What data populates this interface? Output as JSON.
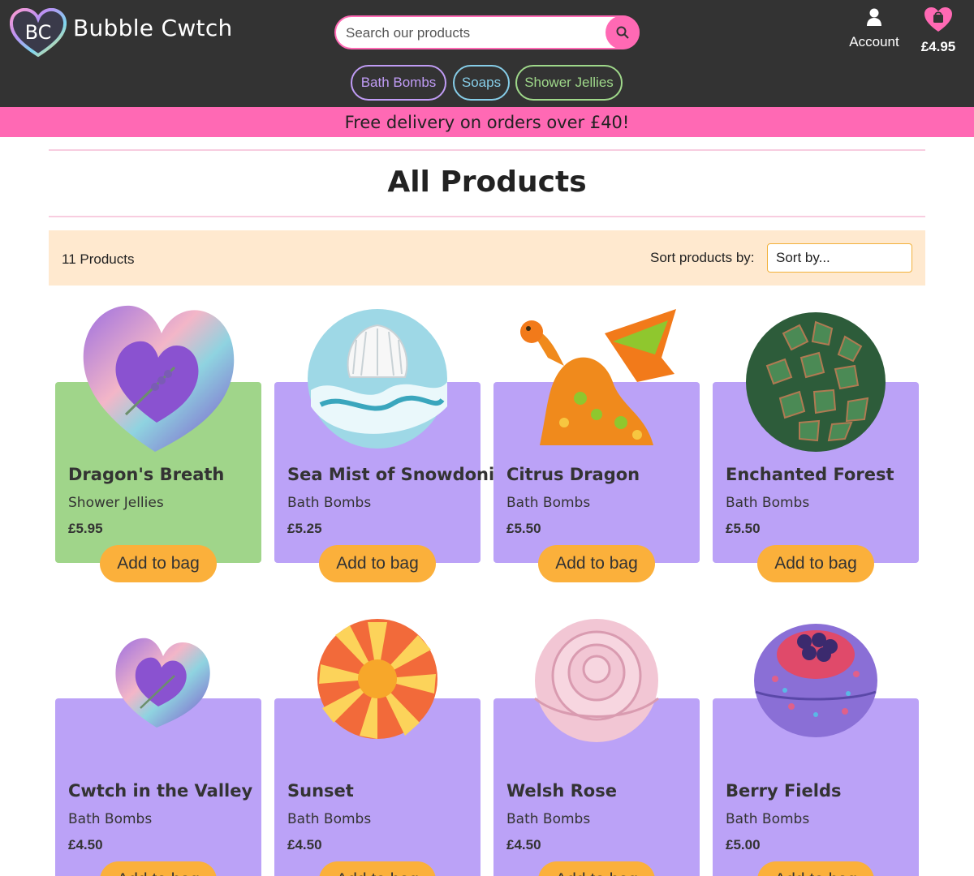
{
  "header": {
    "logo_text": "BC",
    "brand": "Bubble Cwtch",
    "search_placeholder": "Search our products",
    "account_label": "Account",
    "bag_total": "£4.95"
  },
  "categories": [
    "Bath Bombs",
    "Soaps",
    "Shower Jellies"
  ],
  "promo": "Free delivery on orders over £40!",
  "page_title": "All Products",
  "toolbar": {
    "count": "11 Products",
    "sort_label": "Sort products by:",
    "sort_value": "Sort by..."
  },
  "products": [
    {
      "name": "Dragon's Breath",
      "category": "Shower Jellies",
      "price": "£5.95",
      "button": "Add to bag",
      "bg": "#a0d58a",
      "icon": "heart-bath-bomb"
    },
    {
      "name": "Sea Mist of Snowdonia",
      "category": "Bath Bombs",
      "price": "£5.25",
      "button": "Add to bag",
      "bg": "#bba2f7",
      "icon": "shell-bath-bomb"
    },
    {
      "name": "Citrus Dragon",
      "category": "Bath Bombs",
      "price": "£5.50",
      "button": "Add to bag",
      "bg": "#bba2f7",
      "icon": "dragon-bath-bomb"
    },
    {
      "name": "Enchanted Forest",
      "category": "Bath Bombs",
      "price": "£5.50",
      "button": "Add to bag",
      "bg": "#bba2f7",
      "icon": "pinecone-bath-bomb"
    },
    {
      "name": "Cwtch in the Valley",
      "category": "Bath Bombs",
      "price": "£4.50",
      "button": "Add to bag",
      "bg": "#bba2f7",
      "icon": "heart-bath-bomb"
    },
    {
      "name": "Sunset",
      "category": "Bath Bombs",
      "price": "£4.50",
      "button": "Add to bag",
      "bg": "#bba2f7",
      "icon": "sunburst-bath-bomb"
    },
    {
      "name": "Welsh Rose",
      "category": "Bath Bombs",
      "price": "£4.50",
      "button": "Add to bag",
      "bg": "#bba2f7",
      "icon": "rose-bath-bomb"
    },
    {
      "name": "Berry Fields",
      "category": "Bath Bombs",
      "price": "£5.00",
      "button": "Add to bag",
      "bg": "#bba2f7",
      "icon": "berry-bath-bomb"
    }
  ]
}
